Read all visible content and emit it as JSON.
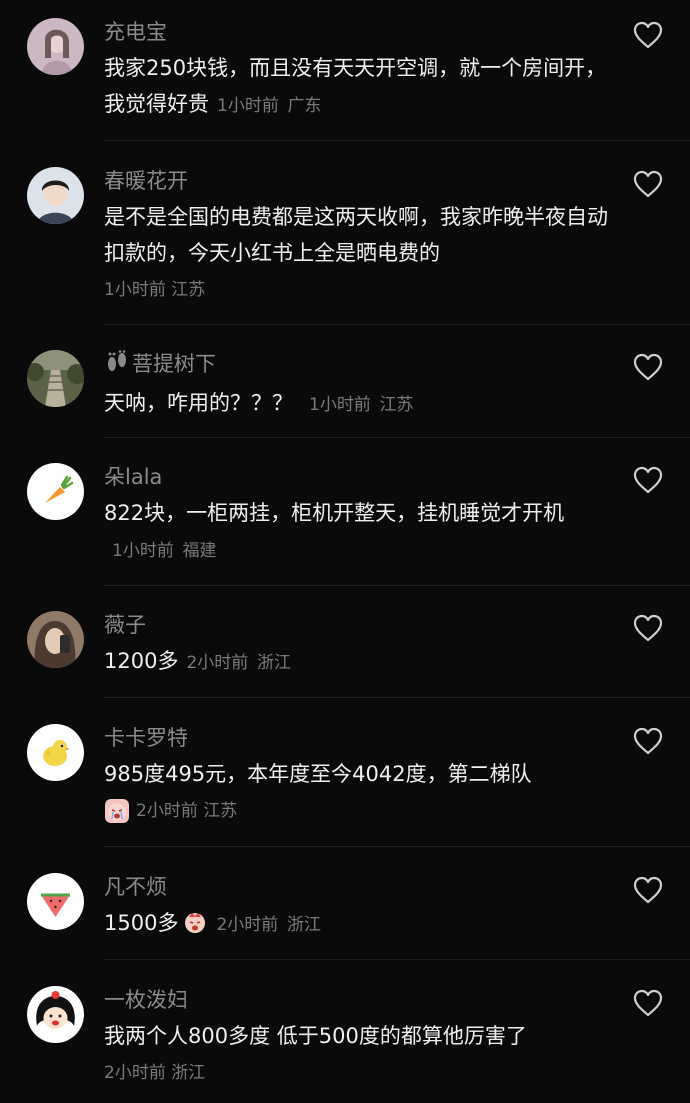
{
  "comments": [
    {
      "username": "充电宝",
      "text": "我家250块钱，而且没有天天开空调，就一个房间开，我觉得好贵",
      "time": "1小时前",
      "location": "广东",
      "avatar": "photo-avatar"
    },
    {
      "username": "春暖花开",
      "text": "是不是全国的电费都是这两天收啊，我家昨晚半夜自动扣款的，今天小红书上全是晒电费的",
      "time": "1小时前",
      "location": "江苏",
      "avatar": "photo-avatar"
    },
    {
      "username": "菩提树下",
      "text": "天呐，咋用的？？？",
      "time": "1小时前",
      "location": "江苏",
      "avatar": "photo-avatar"
    },
    {
      "username": "朵lala",
      "text": "822块，一柜两挂，柜机开整天，挂机睡觉才开机",
      "time": "1小时前",
      "location": "福建",
      "avatar": "carrot-avatar"
    },
    {
      "username": "薇子",
      "text": "1200多",
      "time": "2小时前",
      "location": "浙江",
      "avatar": "photo-avatar"
    },
    {
      "username": "卡卡罗特",
      "text": "985度495元，本年度至今4042度，第二梯队",
      "time": "2小时前",
      "location": "江苏",
      "avatar": "chick-avatar",
      "trailing_emoji": "crying-emoji"
    },
    {
      "username": "凡不烦",
      "text": "1500多",
      "time": "2小时前",
      "location": "浙江",
      "avatar": "watermelon-avatar",
      "inline_emoji": "crying-emoji"
    },
    {
      "username": "一枚泼妇",
      "text": "我两个人800多度 低于500度的都算他厉害了",
      "time": "2小时前",
      "location": "浙江",
      "avatar": "cartoon-avatar"
    }
  ],
  "colors": {
    "background": "#0a0a0a",
    "username": "#8a8a8a",
    "text": "#efefef",
    "meta": "#7a7a7a",
    "divider": "#1f1f1f"
  }
}
